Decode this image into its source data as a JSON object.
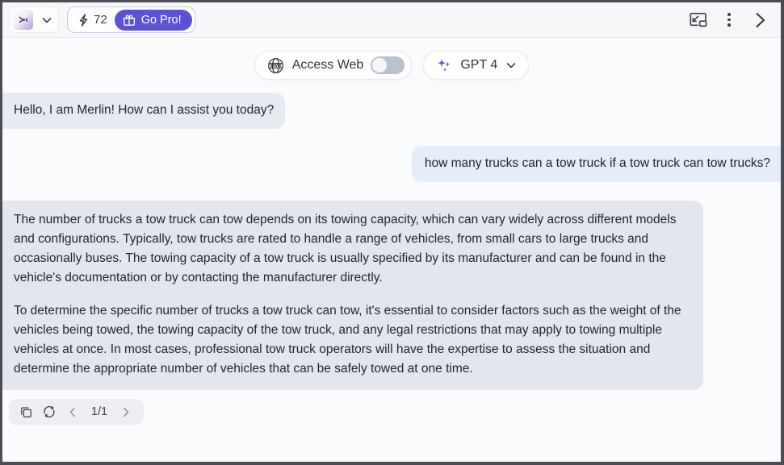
{
  "header": {
    "logo_glyph": "≻‹",
    "logo_name": "merlin-logo",
    "dropdown_icon": "chevron-down-icon",
    "credits": {
      "bolt_icon": "lightning-bolt-icon",
      "count": "72",
      "gift_icon": "gift-icon",
      "go_pro_label": "Go Pro!"
    },
    "right_icons": [
      {
        "name": "picture-in-picture-icon",
        "label": "Picture in picture"
      },
      {
        "name": "more-options-icon",
        "label": "More options"
      },
      {
        "name": "chevron-right-icon",
        "label": "Collapse panel"
      }
    ]
  },
  "toolbar": {
    "access_web": {
      "icon": "globe-www-icon",
      "label": "Access Web",
      "toggle_state": "off"
    },
    "model": {
      "icon": "sparkles-icon",
      "label": "GPT 4",
      "chevron": "chevron-down-icon"
    }
  },
  "chat": {
    "messages": [
      {
        "role": "assistant",
        "kind": "greeting",
        "text": "Hello, I am Merlin! How can I assist you today?"
      },
      {
        "role": "user",
        "kind": "question",
        "text": "how many trucks can a tow truck if a tow truck can tow trucks?"
      },
      {
        "role": "assistant",
        "kind": "answer",
        "paragraph_1": "The number of trucks a tow truck can tow depends on its towing capacity, which can vary widely across different models and configurations. Typically, tow trucks are rated to handle a range of vehicles, from small cars to large trucks and occasionally buses. The towing capacity of a tow truck is usually specified by its manufacturer and can be found in the vehicle's documentation or by contacting the manufacturer directly.",
        "paragraph_2": "To determine the specific number of trucks a tow truck can tow, it's essential to consider factors such as the weight of the vehicles being towed, the towing capacity of the tow truck, and any legal restrictions that may apply to towing multiple vehicles at once. In most cases, professional tow truck operators will have the expertise to assess the situation and determine the appropriate number of vehicles that can be safely towed at one time."
      }
    ]
  },
  "message_actions": {
    "copy_icon": "copy-icon",
    "regenerate_icon": "refresh-icon",
    "prev_icon": "chevron-left-icon",
    "page_indicator": "1/1",
    "next_icon": "chevron-right-icon"
  },
  "colors": {
    "accent_purple": "#5b52d4",
    "assistant_bubble": "#e3e6ed",
    "user_bubble": "#e5ecfa",
    "page_background": "#fafbfd",
    "header_background": "#f6f7f9"
  }
}
